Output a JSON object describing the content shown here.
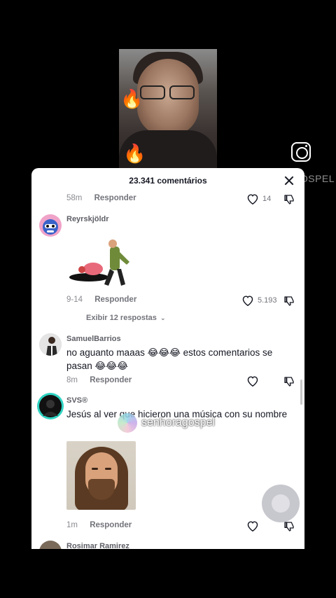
{
  "video": {
    "overlay_text": "...",
    "fire_emoji": "🔥"
  },
  "social": {
    "icon": "instagram-icon",
    "handle": "@SENHORAGOSPEL"
  },
  "sheet": {
    "title": "23.341 comentários",
    "close_icon": "close-icon"
  },
  "comments": [
    {
      "time": "58m",
      "reply_label": "Responder",
      "likes": "14"
    },
    {
      "username": "Reyrskjöldr",
      "time": "9-14",
      "reply_label": "Responder",
      "likes": "5.193",
      "sticker": "dancing-cartoon-sticker",
      "view_replies": "Exibir 12 respostas"
    },
    {
      "username": "SamuelBarrios",
      "text_line1": "no aguanto maaas 😂😂😂 estos comentarios se",
      "text_line2": "pasan 😂😂😂",
      "time": "8m",
      "reply_label": "Responder"
    },
    {
      "username": "SVS®",
      "text_line1": "Jesús al ver que hicieron una música con su nombre",
      "time": "1m",
      "reply_label": "Responder",
      "sticker": "crying-jesus-sticker"
    },
    {
      "username": "Rosimar Ramirez"
    }
  ],
  "watermark": {
    "text": "senhoragospel"
  },
  "colors": {
    "text_primary": "#161823",
    "text_secondary": "#8a8b91",
    "sheet_bg": "#ffffff",
    "page_bg": "#000000"
  }
}
